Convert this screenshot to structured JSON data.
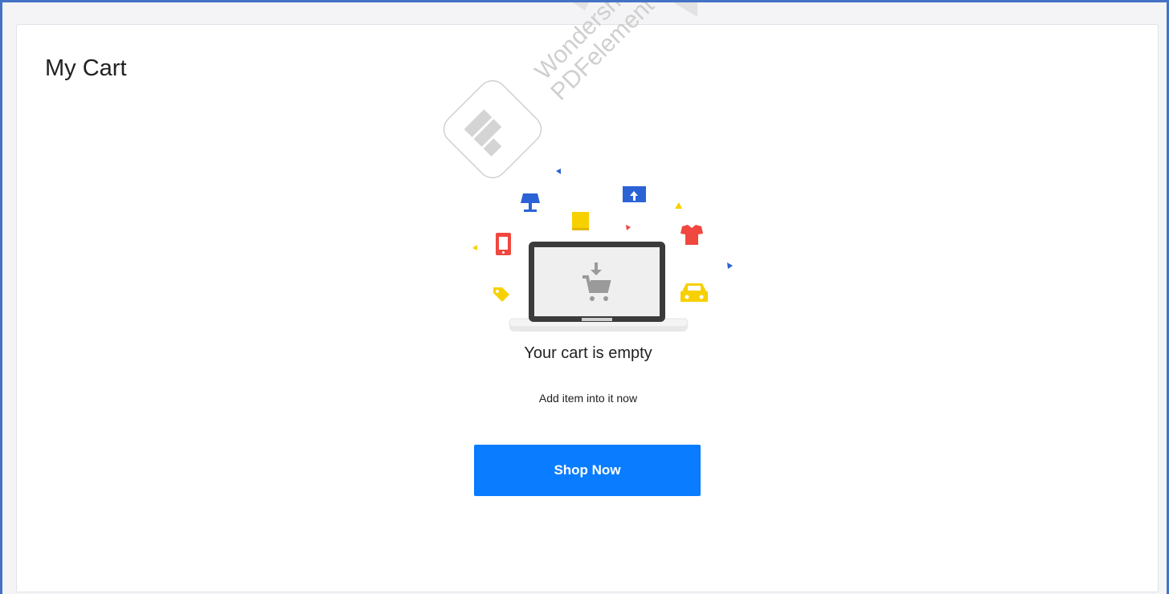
{
  "page": {
    "title": "My Cart"
  },
  "empty_state": {
    "heading": "Your cart is empty",
    "subtext": "Add item into it now",
    "button_label": "Shop Now"
  },
  "watermark": {
    "line1": "Wondershare",
    "line2": "PDFelement"
  },
  "colors": {
    "accent": "#0a7cff",
    "frame_border": "#4472c4",
    "icon_blue": "#2b63d6",
    "icon_red": "#f0473f",
    "icon_yellow": "#f7d000"
  }
}
